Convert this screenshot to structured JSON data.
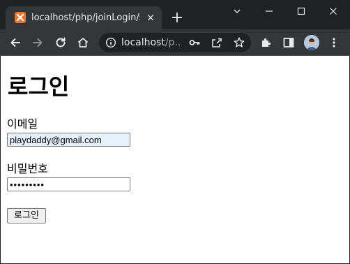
{
  "browser": {
    "tab_favicon_glyph": "☒",
    "tab_title": "localhost/php/joinLogin/sign",
    "tab_close": "×",
    "new_tab": "+",
    "url_host": "localhost",
    "url_rest": "/p...",
    "icons": {
      "back": "arrow-left-icon",
      "forward": "arrow-right-icon",
      "reload": "reload-icon",
      "home": "home-icon",
      "site_info": "info-icon",
      "password": "key-icon",
      "share": "share-icon",
      "bookmark": "star-icon",
      "extensions": "puzzle-icon",
      "side_panel": "side-panel-icon",
      "menu": "kebab-menu-icon"
    },
    "colors": {
      "frame": "#202124",
      "toolbar": "#35363a",
      "tab_favicon": "#e8772e",
      "autofill": "#e8f0fe"
    }
  },
  "page": {
    "title": "로그인",
    "email_label": "이메일",
    "email_value": "playdaddy@gmail.com",
    "password_label": "비밀번호",
    "password_value": "•••••••••",
    "submit_label": "로그인"
  }
}
